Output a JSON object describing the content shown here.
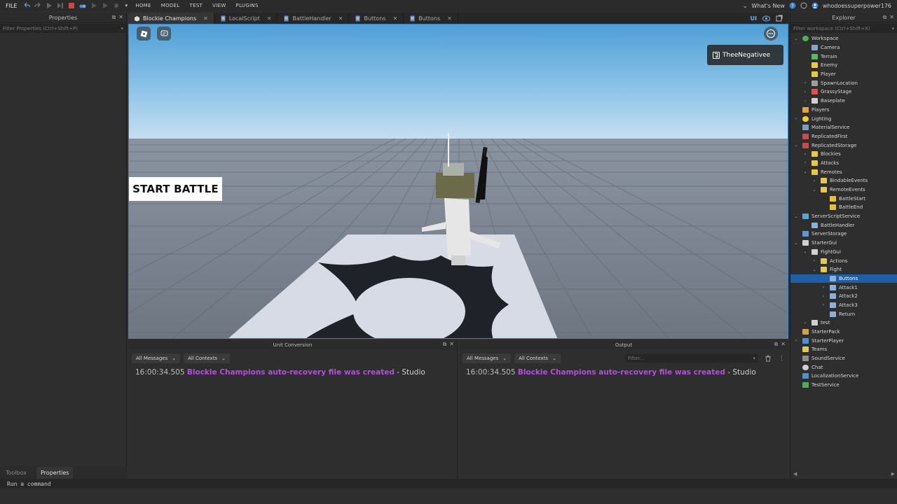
{
  "topbar": {
    "file_label": "FILE",
    "menu": [
      "HOME",
      "MODEL",
      "TEST",
      "VIEW",
      "PLUGINS"
    ],
    "whats_new": "What's New",
    "username": "whodoessuperpower176"
  },
  "left_panel": {
    "title": "Properties",
    "filter_placeholder": "Filter Properties (Ctrl+Shift+P)",
    "bottom_tabs": [
      "Toolbox",
      "Properties"
    ]
  },
  "tabs": [
    {
      "label": "Blockie Champions",
      "active": true
    },
    {
      "label": "LocalScript",
      "active": false
    },
    {
      "label": "BattleHandler",
      "active": false
    },
    {
      "label": "Buttons",
      "active": false
    },
    {
      "label": "Buttons",
      "active": false
    }
  ],
  "tab_right_label": "UI",
  "viewport": {
    "player_name": "TheeNegativee",
    "start_button": "START BATTLE"
  },
  "unit_conversion": {
    "title": "Unit Conversion",
    "messages_dropdown": "All Messages",
    "contexts_dropdown": "All Contexts",
    "log": {
      "time": "16:00:34.505",
      "message": "Blockie Champions auto-recovery file was created",
      "sep": "-",
      "source": "Studio"
    }
  },
  "output": {
    "title": "Output",
    "messages_dropdown": "All Messages",
    "contexts_dropdown": "All Contexts",
    "filter_placeholder": "Filter...",
    "log": {
      "time": "16:00:34.505",
      "message": "Blockie Champions auto-recovery file was created",
      "sep": "-",
      "source": "Studio"
    }
  },
  "explorer": {
    "title": "Explorer",
    "filter_placeholder": "Filter workspace (Ctrl+Shift+X)",
    "items": [
      {
        "label": "Workspace",
        "depth": 0,
        "arrow": "open",
        "icon": "globe",
        "color": "#4caf50"
      },
      {
        "label": "Camera",
        "depth": 1,
        "arrow": "",
        "icon": "camera",
        "color": "#8aa4c8"
      },
      {
        "label": "Terrain",
        "depth": 1,
        "arrow": "",
        "icon": "terrain",
        "color": "#5bb860"
      },
      {
        "label": "Enemy",
        "depth": 1,
        "arrow": "",
        "icon": "folder",
        "color": "#e6c84a"
      },
      {
        "label": "Player",
        "depth": 1,
        "arrow": "",
        "icon": "folder",
        "color": "#e6c84a"
      },
      {
        "label": "SpawnLocation",
        "depth": 1,
        "arrow": "closed",
        "icon": "spawn",
        "color": "#9e9e9e"
      },
      {
        "label": "GrassyStage",
        "depth": 1,
        "arrow": "closed",
        "icon": "model",
        "color": "#d9534f"
      },
      {
        "label": "Baseplate",
        "depth": 1,
        "arrow": "closed",
        "icon": "part",
        "color": "#d0d0d0"
      },
      {
        "label": "Players",
        "depth": 0,
        "arrow": "",
        "icon": "players",
        "color": "#e6a03c"
      },
      {
        "label": "Lighting",
        "depth": 0,
        "arrow": "closed",
        "icon": "lighting",
        "color": "#f0d030"
      },
      {
        "label": "MaterialService",
        "depth": 0,
        "arrow": "",
        "icon": "service",
        "color": "#7c9cc8"
      },
      {
        "label": "ReplicatedFirst",
        "depth": 0,
        "arrow": "",
        "icon": "service",
        "color": "#d04848"
      },
      {
        "label": "ReplicatedStorage",
        "depth": 0,
        "arrow": "open",
        "icon": "service",
        "color": "#d04848"
      },
      {
        "label": "Blockies",
        "depth": 1,
        "arrow": "closed",
        "icon": "folder",
        "color": "#e6c84a"
      },
      {
        "label": "Attacks",
        "depth": 1,
        "arrow": "closed",
        "icon": "folder",
        "color": "#e6c84a"
      },
      {
        "label": "Remotes",
        "depth": 1,
        "arrow": "open",
        "icon": "folder",
        "color": "#e6c84a"
      },
      {
        "label": "BindableEvents",
        "depth": 2,
        "arrow": "closed",
        "icon": "folder",
        "color": "#e6c84a"
      },
      {
        "label": "RemoteEvents",
        "depth": 2,
        "arrow": "open",
        "icon": "folder",
        "color": "#e6c84a"
      },
      {
        "label": "BattleStart",
        "depth": 3,
        "arrow": "",
        "icon": "remote-event",
        "color": "#e8c040"
      },
      {
        "label": "BattleEnd",
        "depth": 3,
        "arrow": "",
        "icon": "remote-event",
        "color": "#e8c040"
      },
      {
        "label": "ServerScriptService",
        "depth": 0,
        "arrow": "open",
        "icon": "service",
        "color": "#4fa8d8"
      },
      {
        "label": "BattleHandler",
        "depth": 1,
        "arrow": "",
        "icon": "script",
        "color": "#8db0d8"
      },
      {
        "label": "ServerStorage",
        "depth": 0,
        "arrow": "",
        "icon": "service",
        "color": "#5a9ad8"
      },
      {
        "label": "StarterGui",
        "depth": 0,
        "arrow": "open",
        "icon": "gui",
        "color": "#d0d0d0"
      },
      {
        "label": "FightGui",
        "depth": 1,
        "arrow": "open",
        "icon": "gui",
        "color": "#d0d0d0"
      },
      {
        "label": "Actions",
        "depth": 2,
        "arrow": "closed",
        "icon": "frame",
        "color": "#e6c84a"
      },
      {
        "label": "Fight",
        "depth": 2,
        "arrow": "open",
        "icon": "frame",
        "color": "#e6c84a"
      },
      {
        "label": "Buttons",
        "depth": 3,
        "arrow": "",
        "icon": "script",
        "color": "#8db0d8",
        "selected": true
      },
      {
        "label": "Attack1",
        "depth": 3,
        "arrow": "closed",
        "icon": "button",
        "color": "#8db0d8"
      },
      {
        "label": "Attack2",
        "depth": 3,
        "arrow": "closed",
        "icon": "button",
        "color": "#8db0d8"
      },
      {
        "label": "Attack3",
        "depth": 3,
        "arrow": "closed",
        "icon": "button",
        "color": "#8db0d8"
      },
      {
        "label": "Return",
        "depth": 3,
        "arrow": "",
        "icon": "button",
        "color": "#8db0d8"
      },
      {
        "label": "test",
        "depth": 1,
        "arrow": "closed",
        "icon": "gui",
        "color": "#d0d0d0"
      },
      {
        "label": "StarterPack",
        "depth": 0,
        "arrow": "",
        "icon": "service",
        "color": "#d8a048"
      },
      {
        "label": "StarterPlayer",
        "depth": 0,
        "arrow": "closed",
        "icon": "service",
        "color": "#4a90d8"
      },
      {
        "label": "Teams",
        "depth": 0,
        "arrow": "",
        "icon": "folder",
        "color": "#e6c84a"
      },
      {
        "label": "SoundService",
        "depth": 0,
        "arrow": "",
        "icon": "sound",
        "color": "#8e8e8e"
      },
      {
        "label": "Chat",
        "depth": 0,
        "arrow": "",
        "icon": "chat",
        "color": "#d0d0d0"
      },
      {
        "label": "LocalizationService",
        "depth": 0,
        "arrow": "",
        "icon": "service",
        "color": "#4a90d8"
      },
      {
        "label": "TestService",
        "depth": 0,
        "arrow": "",
        "icon": "service",
        "color": "#4caf50"
      }
    ]
  },
  "command_bar": {
    "placeholder": "Run a command"
  },
  "colors": {
    "accent": "#3a86c8",
    "log_message": "#b64ce0",
    "selection": "#1e5fa8"
  }
}
